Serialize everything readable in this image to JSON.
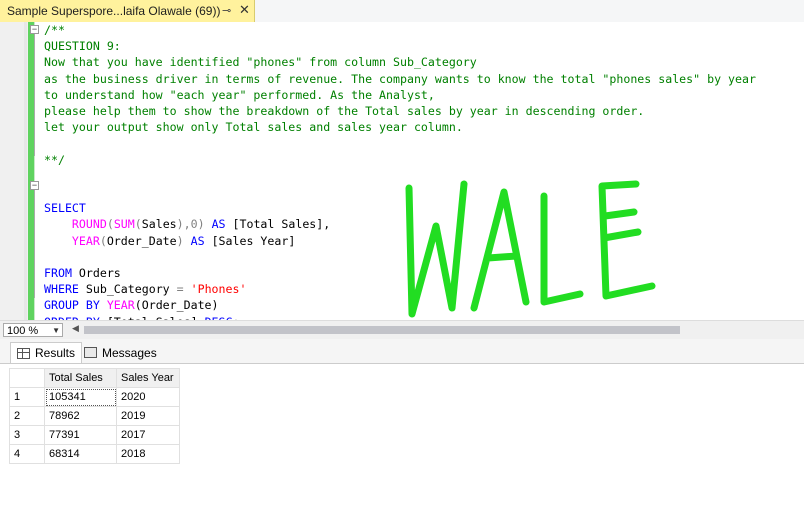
{
  "tab": {
    "title": "Sample Superspore...laifa Olawale (69))",
    "pin_icon": "pin-icon",
    "close_icon": "close-icon",
    "close_glyph": "✕"
  },
  "code": {
    "comment_open": "/**",
    "question": "QUESTION 9:",
    "line1": "Now that you have identified \"phones\" from column Sub_Category",
    "line2": "as the business driver in terms of revenue. The company wants to know the total \"phones sales\" by year",
    "line3": "to understand how \"each year\" performed. As the Analyst,",
    "line4": "please help them to show the breakdown of the Total sales by year in descending order.",
    "line5": "let your output show only Total sales and sales year column.",
    "comment_close": "**/",
    "select": "SELECT",
    "round_fn": "ROUND",
    "paren_open": "(",
    "sum_fn": "SUM",
    "sales_arg": "Sales",
    "round_rest": "),0)",
    "as1": "AS",
    "alias1": "[Total Sales],",
    "year_fn": "YEAR",
    "year_arg": "Order_Date",
    "paren_close": ")",
    "as2": "AS",
    "alias2": "[Sales Year]",
    "from": "FROM",
    "table": "Orders",
    "where": "WHERE",
    "where_col": "Sub_Category",
    "eq": "=",
    "where_val": "'Phones'",
    "group_by": "GROUP BY",
    "group_fn": "YEAR",
    "group_arg": "(Order_Date)",
    "order_by": "ORDER BY",
    "order_col": "[Total Sales]",
    "desc": "DESC",
    "semicolon": ";"
  },
  "zoom": {
    "value": "100 %"
  },
  "results_tabs": {
    "results": "Results",
    "messages": "Messages"
  },
  "grid": {
    "headers": [
      "Total Sales",
      "Sales Year"
    ],
    "rows": [
      {
        "n": "1",
        "total": "105341",
        "year": "2020"
      },
      {
        "n": "2",
        "total": "78962",
        "year": "2019"
      },
      {
        "n": "3",
        "total": "77391",
        "year": "2017"
      },
      {
        "n": "4",
        "total": "68314",
        "year": "2018"
      }
    ]
  },
  "watermark": {
    "text": "WALE",
    "color": "#22dd22"
  },
  "colors": {
    "tab_bg": "#fff29d",
    "change_bar": "#5fd35f",
    "comment": "#008000",
    "keyword": "#0000ff",
    "function": "#ff00ff",
    "string": "#ff0000"
  }
}
